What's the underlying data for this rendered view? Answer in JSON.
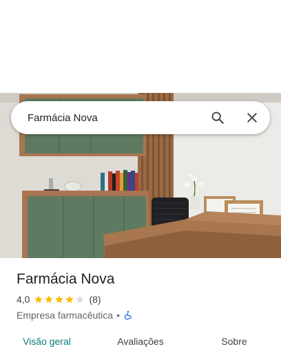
{
  "search": {
    "query": "Farmácia Nova"
  },
  "place": {
    "title": "Farmácia Nova",
    "rating": "4,0",
    "stars": 4,
    "stars_max": 5,
    "review_count": "(8)",
    "category": "Empresa farmacêutica",
    "separator": "•",
    "accessibility_icon": "wheelchair-icon"
  },
  "tabs": [
    {
      "label": "Visão geral",
      "active": true
    },
    {
      "label": "Avaliações",
      "active": false
    },
    {
      "label": "Sobre",
      "active": false
    }
  ],
  "colors": {
    "accent": "#0b7a78",
    "star": "#fbbc04",
    "star_empty": "#dadce0",
    "accessibility": "#1a73e8"
  }
}
